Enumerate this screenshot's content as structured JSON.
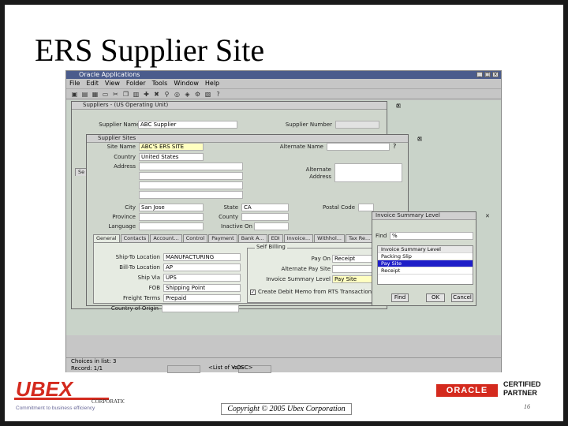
{
  "slide": {
    "title": "ERS Supplier Site",
    "copyright": "Copyright © 2005 Ubex Corporation",
    "page_number": "16"
  },
  "branding": {
    "ubex_logo_text": "UBEX",
    "ubex_corporation": "CORPORATION",
    "ubex_tagline": "Commitment to business efficiency",
    "oracle_logo": "ORACLE",
    "certified_line1": "CERTIFIED",
    "certified_line2": "PARTNER",
    "accent_color": "#d42a1e"
  },
  "app": {
    "title": "Oracle Applications",
    "menu": [
      "File",
      "Edit",
      "View",
      "Folder",
      "Tools",
      "Window",
      "Help"
    ],
    "status_line1": "Choices in list: 3",
    "status_line2": "Record: 1/1",
    "status_field2": "<List of Val>",
    "status_field3": "<OSC>"
  },
  "suppliers_window": {
    "title": "Suppliers - (US Operating Unit)",
    "supplier_name_label": "Supplier Name",
    "supplier_name_value": "ABC Supplier",
    "supplier_number_label": "Supplier Number",
    "supplier_number_value": "",
    "side_tab": "Se"
  },
  "sites_window": {
    "title": "Supplier Sites",
    "site_name_label": "Site Name",
    "site_name_value": "ABC'S ERS SITE",
    "alternate_name_label": "Alternate Name",
    "alternate_name_value": "",
    "country_label": "Country",
    "country_value": "United States",
    "address_label": "Address",
    "alternate_address_label": "Alternate Address",
    "city_label": "City",
    "city_value": "San Jose",
    "state_label": "State",
    "state_value": "CA",
    "postal_code_label": "Postal Code",
    "postal_code_value": "",
    "province_label": "Province",
    "county_label": "County",
    "language_label": "Language",
    "inactive_on_label": "Inactive On",
    "tabs": [
      "General",
      "Contacts",
      "Accounting",
      "Control",
      "Payment",
      "Bank Accounts",
      "EDI",
      "Invoice Tax",
      "Withholding",
      "Tax Reporting"
    ],
    "tab_labels_visible": [
      "General",
      "Contacts",
      "Account...",
      "Control",
      "Payment",
      "Bank A...",
      "EDI",
      "Invoice...",
      "Withhol...",
      "Tax Re..."
    ],
    "ship_to_location_label": "Ship-To Location",
    "ship_to_location_value": "MANUFACTURING",
    "bill_to_location_label": "Bill-To Location",
    "bill_to_location_value": "AP",
    "ship_via_label": "Ship Via",
    "ship_via_value": "UPS",
    "fob_label": "FOB",
    "fob_value": "Shipping Point",
    "freight_terms_label": "Freight Terms",
    "freight_terms_value": "Prepaid",
    "country_of_origin_label": "Country of Origin",
    "country_of_origin_value": "",
    "self_billing_label": "Self Billing",
    "pay_on_label": "Pay On",
    "pay_on_value": "Receipt",
    "alternate_pay_site_label": "Alternate Pay Site",
    "alternate_pay_site_value": "",
    "invoice_summary_level_label": "Invoice Summary Level",
    "invoice_summary_level_value": "Pay Site",
    "checkbox_label": "Create Debit Memo from RTS Transaction"
  },
  "lov_dialog": {
    "title": "Invoice Summary Level",
    "find_label": "Find",
    "find_value": "%",
    "items": [
      "Packing Slip",
      "Pay Site",
      "Receipt"
    ],
    "header_item": "Invoice Summary Level",
    "selected_index": 1,
    "buttons": {
      "find": "Find",
      "ok": "OK",
      "cancel": "Cancel"
    }
  }
}
